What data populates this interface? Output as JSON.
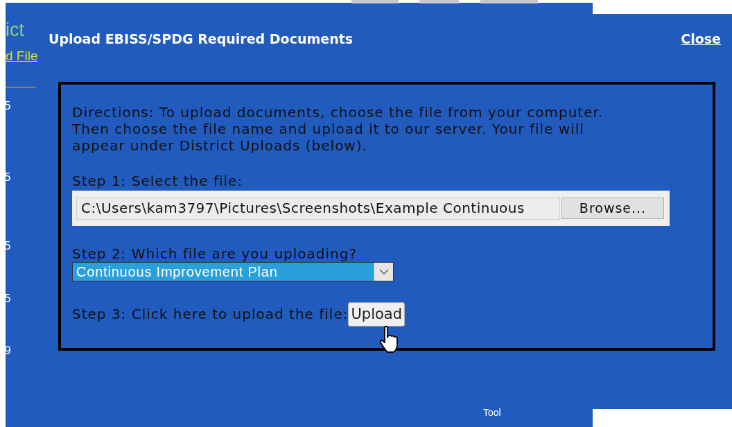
{
  "background_page": {
    "heading_fragment": "ict",
    "link_fragment": "d File",
    "numbers": [
      "5",
      "5",
      "5",
      "5",
      "9"
    ],
    "footer_fragment": "Tool"
  },
  "dialog": {
    "title": "Upload EBISS/SPDG Required Documents",
    "close": "Close",
    "directions": "Directions: To upload documents, choose the file from your computer. Then choose the file name and upload it to our server. Your file will appear under District Uploads (below).",
    "step1": {
      "label": "Step 1: Select the file:",
      "file_path": "C:\\Users\\kam3797\\Pictures\\Screenshots\\Example Continuous",
      "browse": "Browse..."
    },
    "step2": {
      "label": "Step 2: Which file are you uploading?",
      "value": "Continuous Improvement Plan"
    },
    "step3": {
      "label": "Step 3: Click here to upload the file:",
      "button": "Upload"
    }
  }
}
